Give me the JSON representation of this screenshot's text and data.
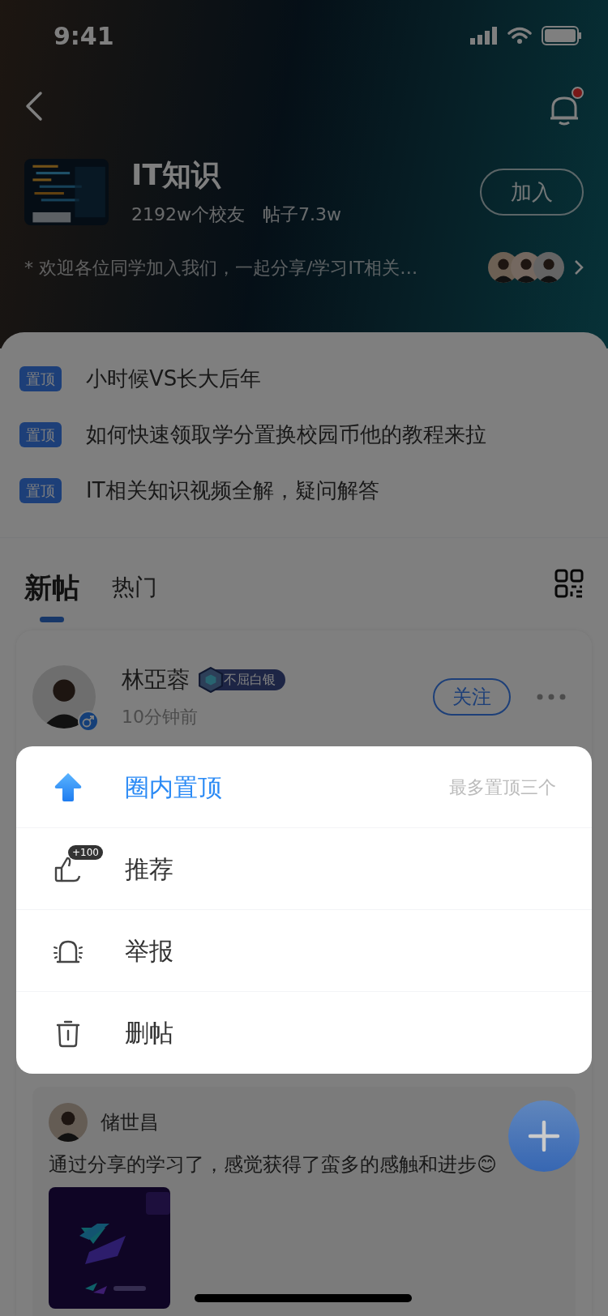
{
  "status_bar": {
    "time": "9:41"
  },
  "header": {
    "has_unread": true
  },
  "group": {
    "name": "IT知识",
    "members": "2192w个校友",
    "posts": "帖子7.3w",
    "join_button": "加入",
    "description": "* 欢迎各位同学加入我们，一起分享/学习IT相关…"
  },
  "pinned": [
    {
      "tag": "置顶",
      "title": "小时候VS长大后年"
    },
    {
      "tag": "置顶",
      "title": "如何快速领取学分置换校园币他的教程来拉"
    },
    {
      "tag": "置顶",
      "title": "IT相关知识视频全解，疑问解答"
    }
  ],
  "tabs": [
    {
      "label": "新帖",
      "selected": true
    },
    {
      "label": "热门",
      "selected": false
    }
  ],
  "post": {
    "author": "林亞蓉",
    "badge": "不屈白银",
    "time": "10分钟前",
    "follow_button": "关注"
  },
  "menu": [
    {
      "kind": "pin",
      "label": "圈内置顶",
      "hint": "最多置顶三个"
    },
    {
      "kind": "recommend",
      "label": "推荐",
      "badge": "+100"
    },
    {
      "kind": "report",
      "label": "举报"
    },
    {
      "kind": "delete",
      "label": "删帖"
    }
  ],
  "shared_post": {
    "author": "储世昌",
    "text": "通过分享的学习了，感觉获得了蛮多的感触和进步😊"
  }
}
